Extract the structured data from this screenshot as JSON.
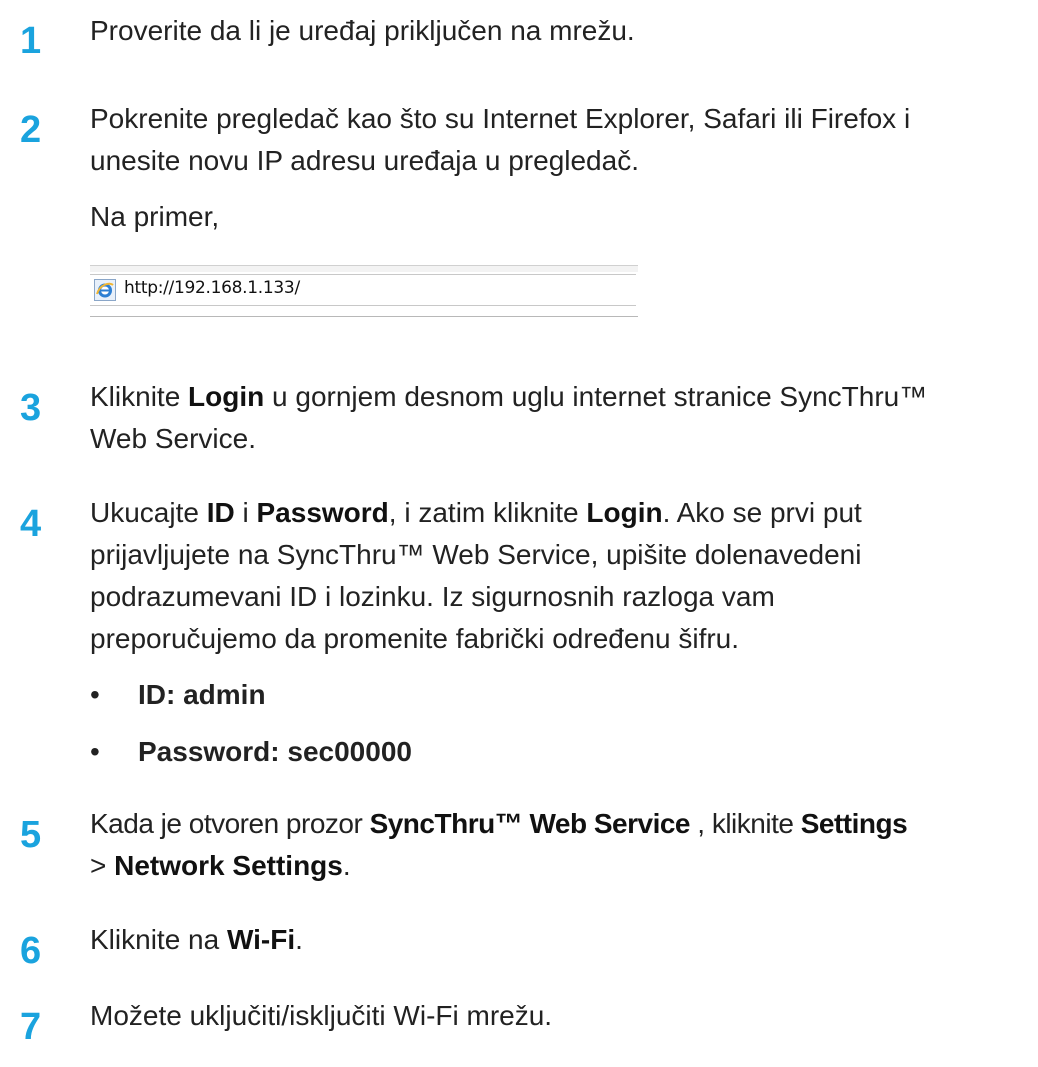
{
  "steps": [
    {
      "number": "1",
      "text": "Proverite da li je uređaj priključen na mrežu."
    },
    {
      "number": "2",
      "text_l1": "Pokrenite pregledač kao što su Internet Explorer, Safari ili Firefox i",
      "text_l2": "unesite novu IP adresu uređaja u pregledač.",
      "example_label": "Na primer,",
      "address_bar": {
        "icon": "ie-browser-icon",
        "url": "http://192.168.1.133/"
      }
    },
    {
      "number": "3",
      "pre": "Kliknite ",
      "bold": "Login",
      "post_l1": " u gornjem desnom uglu internet stranice SyncThru™",
      "l2": "Web Service."
    },
    {
      "number": "4",
      "s1": "Ukucajte ",
      "b1": "ID",
      "s2": " i ",
      "b2": "Password",
      "s3": ", i zatim kliknite ",
      "b3": "Login",
      "s4": ". Ako se prvi put",
      "l2": "prijavljujete na SyncThru™ Web Service, upišite dolenavedeni",
      "l3": "podrazumevani ID i lozinku. Iz sigurnosnih razloga vam",
      "l4": "preporučujemo da promenite fabrički određenu šifru.",
      "bullets": [
        "ID: admin",
        "Password: sec00000"
      ]
    },
    {
      "number": "5",
      "s1": "Kada je otvoren prozor ",
      "b1": "SyncThru™ Web Service",
      "s2": " , kliknite ",
      "b2": "Settings",
      "s3": "> ",
      "b3": "Network Settings",
      "s4": "."
    },
    {
      "number": "6",
      "s1": "Kliknite na ",
      "b1": "Wi-Fi",
      "s2": "."
    },
    {
      "number": "7",
      "text": "Možete uključiti/isključiti Wi-Fi mrežu."
    }
  ],
  "bullet_char": "•",
  "colors": {
    "step_number": "#1aa3de",
    "text": "#222222"
  }
}
